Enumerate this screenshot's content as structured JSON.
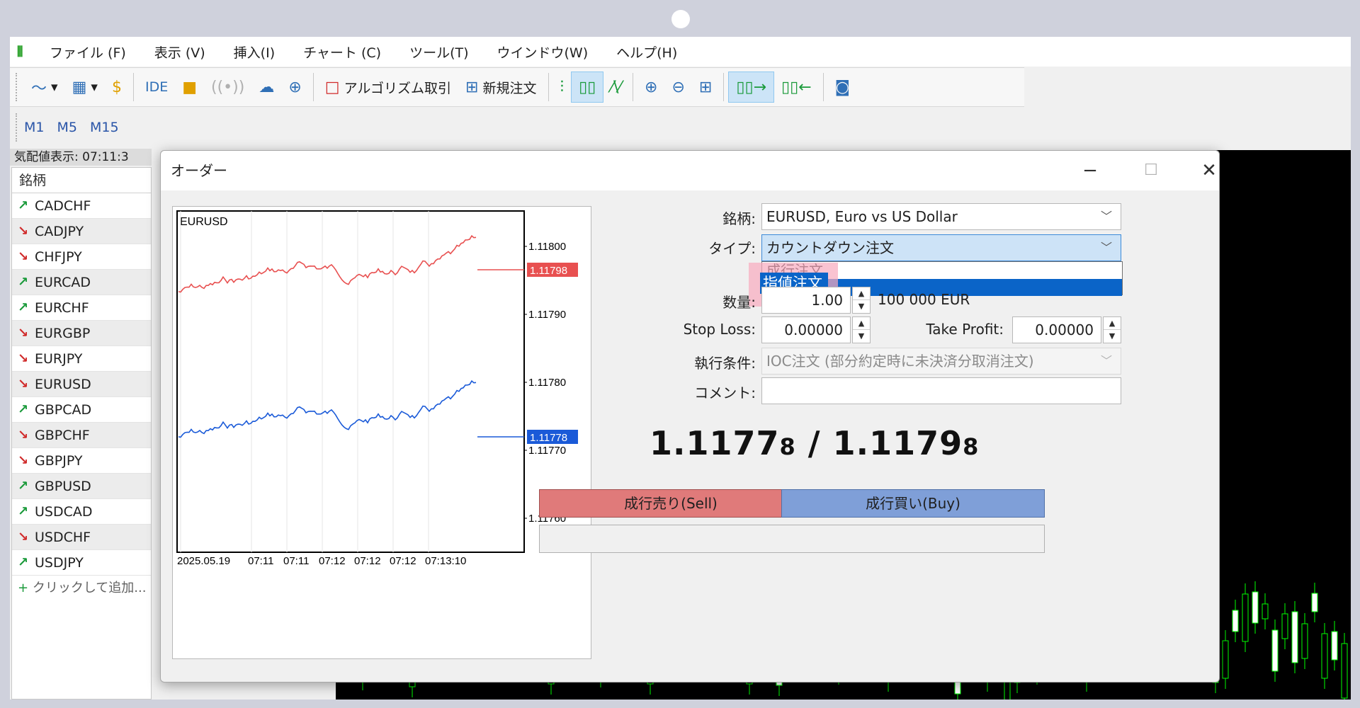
{
  "menu": {
    "items": [
      "ファイル (F)",
      "表示 (V)",
      "挿入(I)",
      "チャート (C)",
      "ツール(T)",
      "ウインドウ(W)",
      "ヘルプ(H)"
    ]
  },
  "toolbar": {
    "ide": "IDE",
    "algo": "アルゴリズム取引",
    "new_order": "新規注文"
  },
  "timeframes": [
    "M1",
    "M5",
    "M15"
  ],
  "market_watch": {
    "title": "気配値表示: 07:11:3",
    "header": "銘柄",
    "symbols": [
      {
        "name": "CADCHF",
        "dir": "up"
      },
      {
        "name": "CADJPY",
        "dir": "down"
      },
      {
        "name": "CHFJPY",
        "dir": "down"
      },
      {
        "name": "EURCAD",
        "dir": "up"
      },
      {
        "name": "EURCHF",
        "dir": "up"
      },
      {
        "name": "EURGBP",
        "dir": "down"
      },
      {
        "name": "EURJPY",
        "dir": "down"
      },
      {
        "name": "EURUSD",
        "dir": "down"
      },
      {
        "name": "GBPCAD",
        "dir": "up"
      },
      {
        "name": "GBPCHF",
        "dir": "down"
      },
      {
        "name": "GBPJPY",
        "dir": "down"
      },
      {
        "name": "GBPUSD",
        "dir": "up"
      },
      {
        "name": "USDCAD",
        "dir": "up"
      },
      {
        "name": "USDCHF",
        "dir": "down"
      },
      {
        "name": "USDJPY",
        "dir": "up"
      }
    ],
    "add_label": "クリックして追加..."
  },
  "dialog": {
    "title": "オーダー",
    "symbol_label": "銘柄:",
    "symbol_value": "EURUSD, Euro vs US Dollar",
    "type_label": "タイプ:",
    "type_value": "カウントダウン注文",
    "type_options": [
      "成行注文",
      "指値注文"
    ],
    "highlight_text": "指値注文",
    "volume_label": "数量:",
    "volume_value": "1.00",
    "volume_amount": "100 000 EUR",
    "sl_label": "Stop Loss:",
    "sl_value": "0.00000",
    "tp_label": "Take Profit:",
    "tp_value": "0.00000",
    "fill_label": "執行条件:",
    "fill_value": "IOC注文 (部分約定時に未決済分取消注文)",
    "comment_label": "コメント:",
    "comment_value": "",
    "bid_main": "1.1177",
    "bid_small": "8",
    "separator": " / ",
    "ask_main": "1.1179",
    "ask_small": "8",
    "sell_label": "成行売り(Sell)",
    "buy_label": "成行買い(Buy)"
  },
  "mini_chart": {
    "symbol": "EURUSD",
    "bid_tag": "1.11778",
    "ask_tag": "1.11798",
    "y_ticks": [
      "1.11800",
      "1.11790",
      "1.11780",
      "1.11770",
      "1.11760"
    ],
    "x_ticks": [
      "2025.05.19",
      "07:11",
      "07:11",
      "07:12",
      "07:12",
      "07:12",
      "07:13:10"
    ],
    "colors": {
      "ask": "#e85050",
      "bid": "#1a5ad8"
    }
  }
}
